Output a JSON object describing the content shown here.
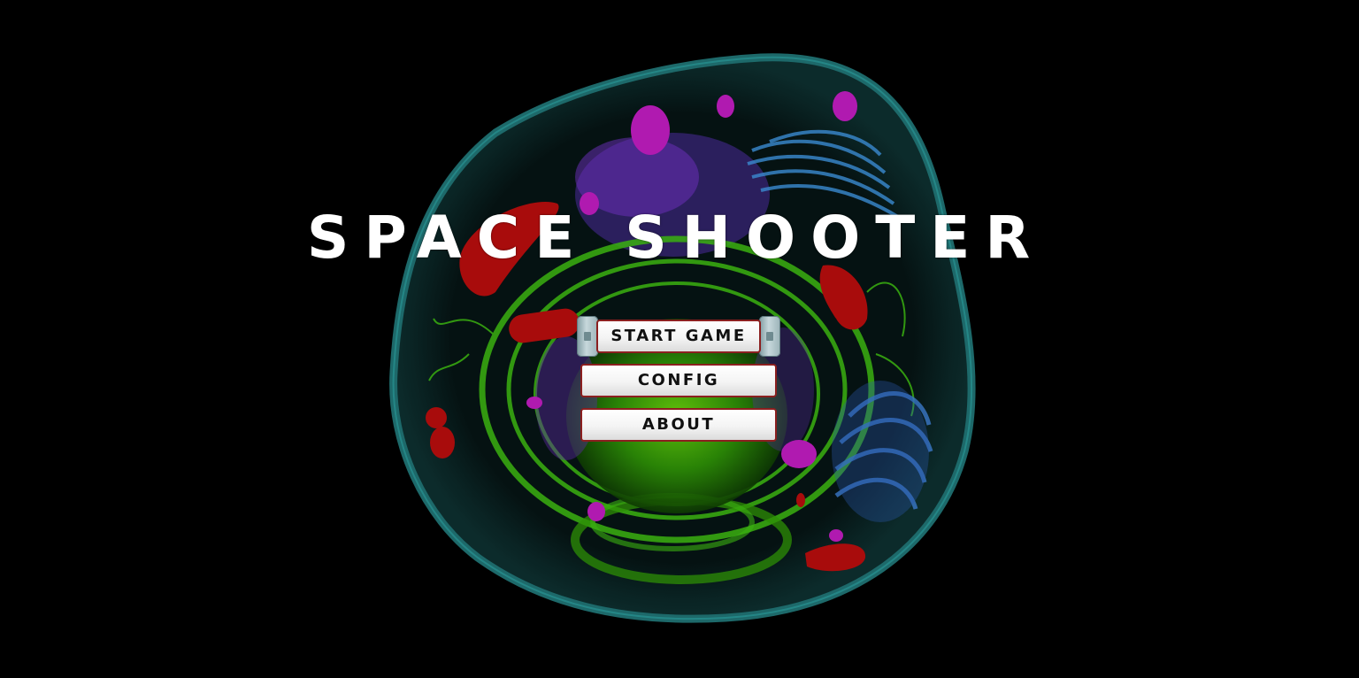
{
  "game": {
    "title": "SPACE SHOOTER",
    "background": "cell-illustration",
    "colors": {
      "background": "#000000",
      "membrane": "#1f7a7a",
      "endoplasmic_reticulum": "#2fae12",
      "vesicle": "#b01ab0",
      "mitochondria": "#b01010",
      "golgi": "#3a78c8"
    }
  },
  "menu": {
    "items": [
      {
        "label": "START GAME",
        "selected": true
      },
      {
        "label": "CONFIG",
        "selected": false
      },
      {
        "label": "ABOUT",
        "selected": false
      }
    ]
  }
}
